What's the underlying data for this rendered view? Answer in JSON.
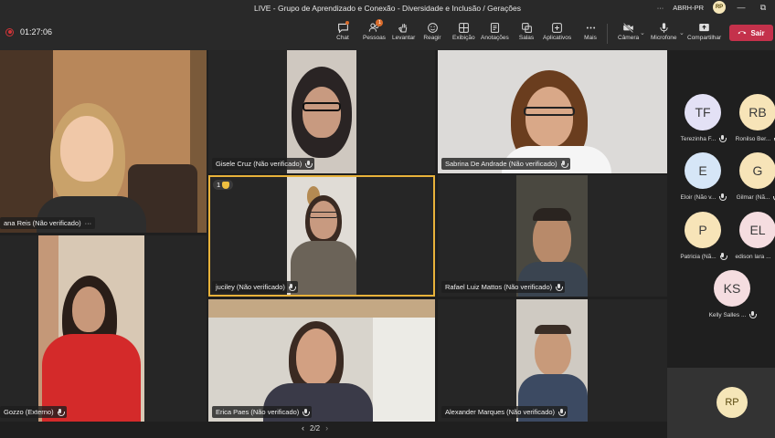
{
  "window": {
    "title": "LIVE - Grupo de Aprendizado e Conexão - Diversidade e Inclusão / Gerações",
    "org": "ABRH-PR",
    "user_initials": "RP",
    "more": "···",
    "minimize": "—",
    "restore": "⧉"
  },
  "meeting": {
    "elapsed": "01:27:06"
  },
  "toolbar": {
    "chat": "Chat",
    "people": "Pessoas",
    "people_badge": "1",
    "raise": "Levantar",
    "react": "Reagir",
    "view": "Exibição",
    "notes": "Anotações",
    "rooms": "Salas",
    "apps": "Aplicativos",
    "more": "Mais",
    "camera": "Câmera",
    "mic": "Microfone",
    "share": "Compartilhar",
    "leave": "Sair"
  },
  "tiles": [
    {
      "name": "ana Reis (Não verificado)"
    },
    {
      "name": "Gisele Cruz (Não verificado)"
    },
    {
      "name": "Sabrina De Andrade (Não verificado)"
    },
    {
      "name": "juciley (Não verificado)",
      "raised_count": "1"
    },
    {
      "name": "Rafael Luiz Mattos (Não verificado)"
    },
    {
      "name": "Gozzo (Externo)"
    },
    {
      "name": "Erica Paes (Não verificado)"
    },
    {
      "name": "Alexander Marques (Não verificado)"
    }
  ],
  "tile_more": "···",
  "pager": {
    "prev": "‹",
    "label": "2/2",
    "next": "›"
  },
  "roster": [
    {
      "initials": "TF",
      "name": "Terezinha F...",
      "color": "#e3e1f5"
    },
    {
      "initials": "RB",
      "name": "Ronilso Ber...",
      "color": "#f7e4b8"
    },
    {
      "initials": "E",
      "name": "Eloir (Não v...",
      "color": "#d6e6f7"
    },
    {
      "initials": "G",
      "name": "Gilmar (Nã...",
      "color": "#f7e4b8"
    },
    {
      "initials": "P",
      "name": "Patricia (Nã...",
      "color": "#f7e4b8"
    },
    {
      "initials": "EL",
      "name": "edison lara ...",
      "color": "#f5dde0"
    },
    {
      "initials": "KS",
      "name": "Kelly Salles ...",
      "color": "#f5dde0"
    }
  ],
  "self": {
    "initials": "RP"
  }
}
